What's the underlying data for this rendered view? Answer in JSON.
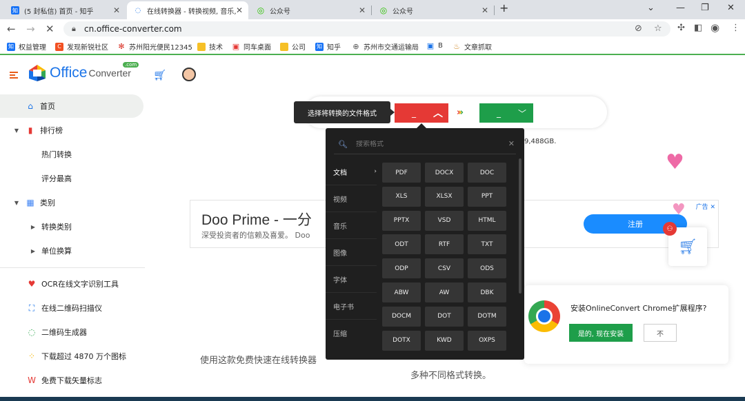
{
  "browser": {
    "tabs": [
      {
        "label": "(5 封私信) 首页 - 知乎",
        "favicon": "知",
        "color": "#1772f6"
      },
      {
        "label": "在线转换器 - 转换视频, 音乐, 图",
        "favicon": "",
        "color": "#1a73e8"
      },
      {
        "label": "公众号",
        "favicon": "",
        "color": "#2dc100"
      },
      {
        "label": "公众号",
        "favicon": "",
        "color": "#2dc100"
      }
    ],
    "new_tab": "+",
    "url": "cn.office-converter.com"
  },
  "bookmarks": [
    {
      "label": "权益管理",
      "icon": "知",
      "color": "#1772f6"
    },
    {
      "label": "发现新锐社区",
      "icon": "C",
      "color": "#f25022"
    },
    {
      "label": "苏州阳光便民12345",
      "icon": "✻",
      "color": "#d93025"
    },
    {
      "label": "技术",
      "icon": "folder",
      "color": "#f6c026"
    },
    {
      "label": "同车桌面",
      "icon": "▣",
      "color": "#e53935"
    },
    {
      "label": "公司",
      "icon": "folder",
      "color": "#f6c026"
    },
    {
      "label": "知乎",
      "icon": "知",
      "color": "#1772f6"
    },
    {
      "label": "苏州市交通运输局",
      "icon": "⊕",
      "color": "#555555"
    },
    {
      "label": "B",
      "icon": "▣",
      "color": "#1a73e8"
    },
    {
      "label": "文章抓取",
      "icon": "♨",
      "color": "#d08a2a"
    }
  ],
  "site": {
    "logo_main": "Office",
    "logo_sub": "Converter",
    "logo_com": ".com"
  },
  "sidebar": {
    "items": [
      {
        "label": "首页",
        "icon": "home-icon"
      },
      {
        "label": "排行榜",
        "icon": "bar-chart-icon"
      },
      {
        "label": "热门转换"
      },
      {
        "label": "评分最高"
      },
      {
        "label": "类别",
        "icon": "category-icon"
      },
      {
        "label": "转换类别"
      },
      {
        "label": "单位换算"
      },
      {
        "label": "OCR在线文字识别工具",
        "icon": "heart-icon"
      },
      {
        "label": "在线二维码扫描仪",
        "icon": "scan-icon"
      },
      {
        "label": "二维码生成器",
        "icon": "qr-icon"
      },
      {
        "label": "下载超过 4870 万个图标",
        "icon": "dots-icon"
      },
      {
        "label": "免费下载矢量标志",
        "icon": "vector-icon"
      }
    ]
  },
  "converter": {
    "tooltip": "选择将转换的文件格式",
    "from_value": "_",
    "to_value": "_",
    "stat_text": "9,488GB."
  },
  "format_panel": {
    "search_placeholder": "搜索格式",
    "categories": [
      "文档",
      "视频",
      "音乐",
      "图像",
      "字体",
      "电子书",
      "压缩"
    ],
    "formats": [
      "PDF",
      "DOCX",
      "DOC",
      "XLS",
      "XLSX",
      "PPT",
      "PPTX",
      "VSD",
      "HTML",
      "ODT",
      "RTF",
      "TXT",
      "ODP",
      "CSV",
      "ODS",
      "ABW",
      "AW",
      "DBK",
      "DOCM",
      "DOT",
      "DOTM",
      "DOTX",
      "KWD",
      "OXPS"
    ]
  },
  "ad": {
    "title": "Doo Prime - 一分",
    "subtitle": "深受投资者的信赖及喜爱。 Doo",
    "badge": "广告 ✕",
    "register": "注册"
  },
  "extension_prompt": {
    "title": "安装OnlineConvert Chrome扩展程序?",
    "yes": "是的, 现在安装",
    "no": "不"
  },
  "description": {
    "line1": "使用这款免费快速在线转换器",
    "line2": "多种不同格式转换。"
  }
}
